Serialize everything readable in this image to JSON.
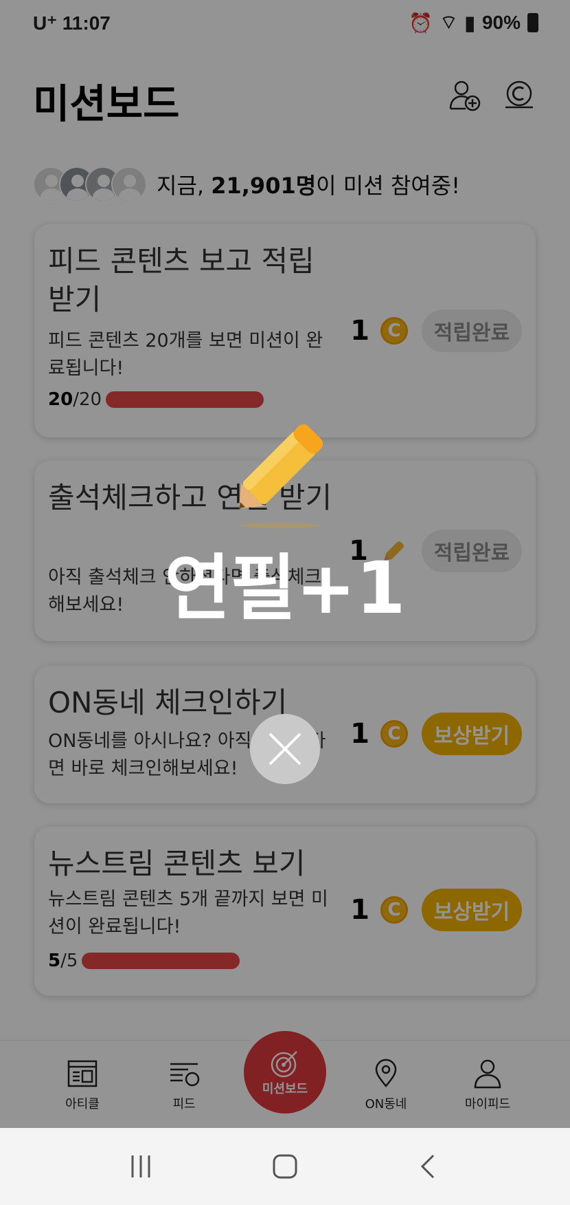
{
  "status_bar": {
    "carrier": "U⁺ 11:07",
    "battery": "90%"
  },
  "header": {
    "title": "미션보드",
    "add_friend_icon": "add-person-icon",
    "coin_icon": "coin-icon"
  },
  "participants": {
    "prefix": "지금, ",
    "count": "21,901명",
    "suffix": "이 미션 참여중!"
  },
  "missions": [
    {
      "title": "피드 콘텐츠 보고 적립 받기",
      "desc": "피드 콘텐츠 20개를 보면 미션이 완료됩니다!",
      "progress_current": "20",
      "progress_total": "/20",
      "progress_fraction": 1.0,
      "reward": "1",
      "reward_icon": "coin-icon",
      "status": "적립완료"
    },
    {
      "title": "출석체크하고 연필 받기",
      "desc": "아직 출석체크 안하셨다면 출석체크해보세요!",
      "reward": "1",
      "reward_icon": "pencil-icon",
      "status": "적립완료"
    },
    {
      "title": "ON동네 체크인하기",
      "desc": "ON동네를 아시나요? 아직 모르신다면 바로 체크인해보세요!",
      "reward": "1",
      "reward_icon": "coin-icon",
      "status": "보상받기"
    },
    {
      "title": "뉴스트림 콘텐츠 보기",
      "desc": "뉴스트림 콘텐츠 5개 끝까지 보면 미션이 완료됩니다!",
      "progress_current": "5",
      "progress_total": "/5",
      "progress_fraction": 1.0,
      "reward": "1",
      "reward_icon": "coin-icon",
      "status": "보상받기"
    }
  ],
  "bottom_nav": {
    "items": [
      {
        "label": "아티클",
        "icon": "article-icon"
      },
      {
        "label": "피드",
        "icon": "feed-icon"
      },
      {
        "label": "미션보드",
        "icon": "target-icon"
      },
      {
        "label": "ON동네",
        "icon": "location-icon"
      },
      {
        "label": "마이피드",
        "icon": "person-icon"
      }
    ]
  },
  "popup": {
    "text": "연필+1",
    "icon": "pencil-icon"
  },
  "colors": {
    "accent": "#e03a3e",
    "coin": "#f8b418",
    "progress": "#e64545",
    "claim_button": "#f3b400"
  }
}
